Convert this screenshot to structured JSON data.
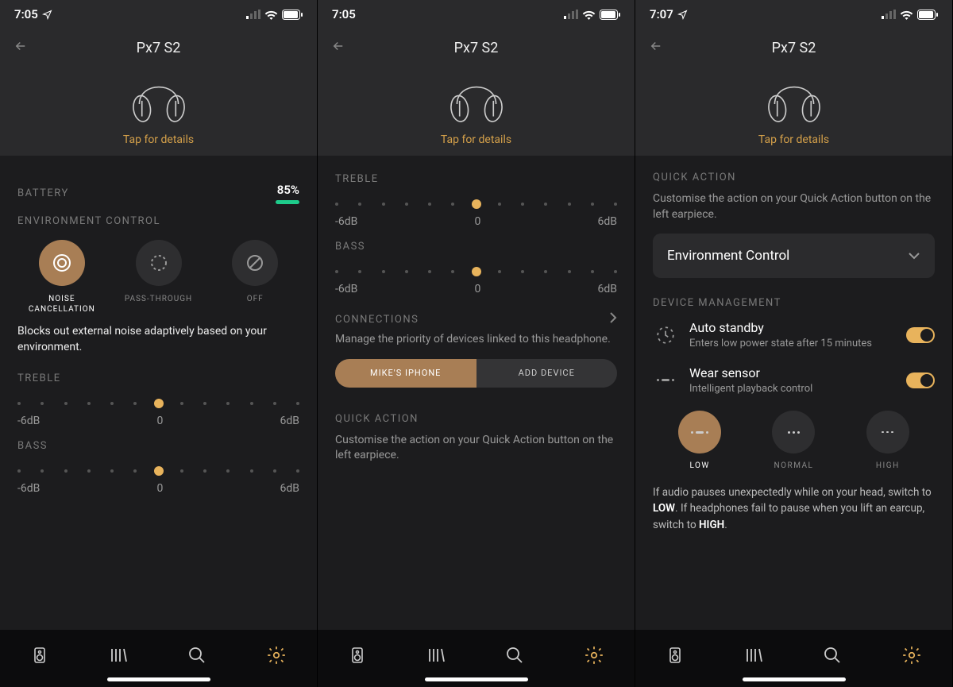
{
  "status": {
    "time_a": "7:05",
    "time_b": "7:05",
    "time_c": "7:07"
  },
  "header": {
    "title": "Px7 S2",
    "tap": "Tap for details"
  },
  "screen1": {
    "battery_label": "BATTERY",
    "battery_pct": "85%",
    "env_label": "ENVIRONMENT CONTROL",
    "env_items": [
      {
        "label": "NOISE CANCELLATION"
      },
      {
        "label": "PASS-THROUGH"
      },
      {
        "label": "OFF"
      }
    ],
    "env_desc": "Blocks out external noise adaptively based on your environment.",
    "treble_label": "TREBLE",
    "bass_label": "BASS",
    "slider_min": "-6dB",
    "slider_mid": "0",
    "slider_max": "6dB"
  },
  "screen2": {
    "treble_label": "TREBLE",
    "bass_label": "BASS",
    "slider_min": "-6dB",
    "slider_mid": "0",
    "slider_max": "6dB",
    "conn_label": "CONNECTIONS",
    "conn_desc": "Manage the priority of devices linked to this headphone.",
    "conn_device": "MIKE'S IPHONE",
    "conn_add": "ADD DEVICE",
    "qa_label": "QUICK ACTION",
    "qa_desc": "Customise the action on your Quick Action button on the left earpiece."
  },
  "screen3": {
    "qa_label": "QUICK ACTION",
    "qa_desc": "Customise the action on your Quick Action button on the left earpiece.",
    "qa_value": "Environment Control",
    "dm_label": "DEVICE MANAGEMENT",
    "auto_title": "Auto standby",
    "auto_sub": "Enters low power state after 15 minutes",
    "wear_title": "Wear sensor",
    "wear_sub": "Intelligent playback control",
    "sens_low": "LOW",
    "sens_normal": "NORMAL",
    "sens_high": "HIGH",
    "sens_note_1": "If audio pauses unexpectedly while on your head, switch to ",
    "sens_note_low": "LOW",
    "sens_note_2": ". If headphones fail to pause when you lift an earcup, switch to ",
    "sens_note_high": "HIGH",
    "sens_note_3": "."
  }
}
